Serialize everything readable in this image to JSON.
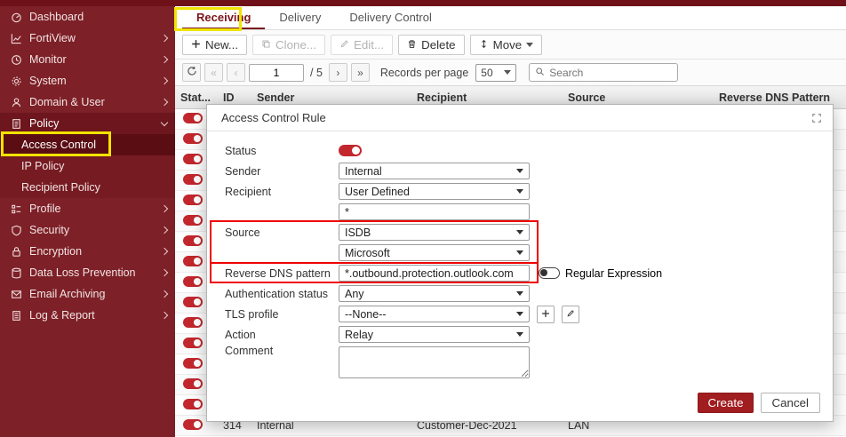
{
  "sidebar": {
    "items": [
      {
        "label": "Dashboard",
        "icon": "dashboard-icon"
      },
      {
        "label": "FortiView",
        "icon": "fortiview-icon",
        "expandable": true
      },
      {
        "label": "Monitor",
        "icon": "monitor-icon",
        "expandable": true
      },
      {
        "label": "System",
        "icon": "system-icon",
        "expandable": true
      },
      {
        "label": "Domain & User",
        "icon": "domain-user-icon",
        "expandable": true
      },
      {
        "label": "Policy",
        "icon": "policy-icon",
        "expanded": true,
        "children": [
          {
            "label": "Access Control",
            "active": true
          },
          {
            "label": "IP Policy"
          },
          {
            "label": "Recipient Policy"
          }
        ]
      },
      {
        "label": "Profile",
        "icon": "profile-icon",
        "expandable": true
      },
      {
        "label": "Security",
        "icon": "security-icon",
        "expandable": true
      },
      {
        "label": "Encryption",
        "icon": "encryption-icon",
        "expandable": true
      },
      {
        "label": "Data Loss Prevention",
        "icon": "dlp-icon",
        "expandable": true
      },
      {
        "label": "Email Archiving",
        "icon": "email-archiving-icon",
        "expandable": true
      },
      {
        "label": "Log & Report",
        "icon": "log-report-icon",
        "expandable": true
      }
    ]
  },
  "tabs": {
    "items": [
      {
        "label": "Receiving",
        "active": true
      },
      {
        "label": "Delivery"
      },
      {
        "label": "Delivery Control"
      }
    ]
  },
  "toolbar": {
    "buttons": [
      {
        "label": "New...",
        "icon": "plus-icon"
      },
      {
        "label": "Clone...",
        "icon": "clone-icon",
        "disabled": true
      },
      {
        "label": "Edit...",
        "icon": "edit-icon",
        "disabled": true
      },
      {
        "label": "Delete",
        "icon": "trash-icon"
      },
      {
        "label": "Move",
        "icon": "move-icon",
        "has_caret": true
      }
    ]
  },
  "pagination": {
    "page_value": "1",
    "page_total": "/ 5",
    "records_per_page_label": "Records per page",
    "records_per_page_value": "50",
    "search_placeholder": "Search"
  },
  "table": {
    "columns": [
      "Stat...",
      "ID",
      "Sender",
      "Recipient",
      "Source",
      "Reverse DNS Pattern"
    ],
    "row_count_visible": 16,
    "visible_row": {
      "id": "314",
      "sender": "Internal",
      "recipient": "Customer-Dec-2021",
      "source": "LAN",
      "reverse_dns": ""
    }
  },
  "dialog": {
    "title": "Access Control Rule",
    "rows": [
      {
        "label": "Status",
        "type": "toggle",
        "state": "on"
      },
      {
        "label": "Sender",
        "type": "select",
        "value": "Internal"
      },
      {
        "label": "Recipient",
        "type": "select",
        "value": "User Defined"
      },
      {
        "label": "",
        "type": "input",
        "value": "*"
      },
      {
        "label": "Source",
        "type": "select",
        "value": "ISDB"
      },
      {
        "label": "",
        "type": "select",
        "value": "Microsoft"
      },
      {
        "label": "Reverse DNS pattern",
        "type": "input",
        "value": "*.outbound.protection.outlook.com",
        "extra_toggle_label": "Regular Expression",
        "extra_toggle_state": "off"
      },
      {
        "label": "Authentication status",
        "type": "select",
        "value": "Any"
      },
      {
        "label": "TLS profile",
        "type": "select",
        "value": "--None--",
        "extra_buttons": [
          "add",
          "edit"
        ]
      },
      {
        "label": "Action",
        "type": "select",
        "value": "Relay"
      },
      {
        "label": "Comment",
        "type": "textarea",
        "value": ""
      }
    ],
    "create_label": "Create",
    "cancel_label": "Cancel"
  },
  "annotations": {
    "highlights": [
      {
        "target": "receiving-tab",
        "color": "#f0e400"
      },
      {
        "target": "access-control-sidebar-item",
        "color": "#f0e400"
      },
      {
        "target": "source-fields",
        "color": "#ee0000"
      },
      {
        "target": "reverse-dns-field",
        "color": "#ee0000"
      }
    ]
  },
  "colors": {
    "sidebar_red": "#7d2027",
    "active_item_red": "#5a0e13",
    "toggle_on_red": "#c1272d",
    "create_button_red": "#a01d20",
    "annotation_yellow": "#f0e400",
    "annotation_red": "#ee0000"
  }
}
